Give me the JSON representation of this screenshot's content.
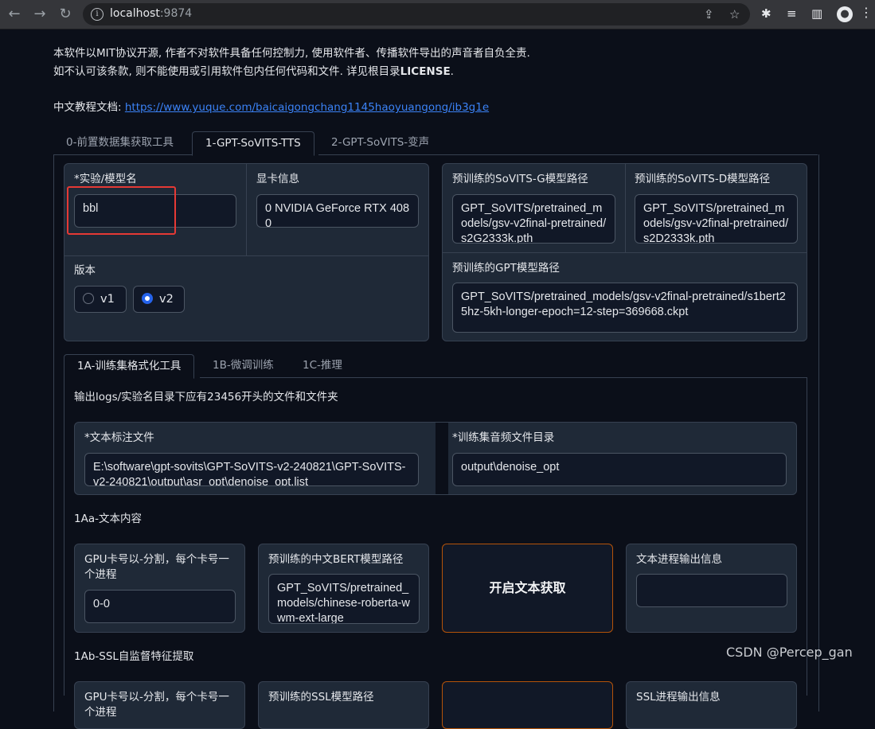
{
  "browser": {
    "url_host": "localhost",
    "url_port": ":9874",
    "back_glyph": "←",
    "forward_glyph": "→",
    "reload_glyph": "↻",
    "info_glyph": "i",
    "share_glyph": "⇪",
    "star_glyph": "☆",
    "extensions_glyph": "✱",
    "media_glyph": "≡",
    "sidepanel_glyph": "▥",
    "profile_glyph": "●",
    "menu_glyph": "⋮"
  },
  "notice": {
    "line1": "本软件以MIT协议开源, 作者不对软件具备任何控制力, 使用软件者、传播软件导出的声音者自负全责.",
    "line2_prefix": "如不认可该条款, 则不能使用或引用软件包内任何代码和文件. 详见根目录",
    "line2_bold": "LICENSE",
    "line2_suffix": ".",
    "tutorial_label": "中文教程文档: ",
    "tutorial_link": "https://www.yuque.com/baicaigongchang1145haoyuangong/ib3g1e"
  },
  "top_tabs": [
    {
      "label": "0-前置数据集获取工具"
    },
    {
      "label": "1-GPT-SoVITS-TTS"
    },
    {
      "label": "2-GPT-SoVITS-变声"
    }
  ],
  "experiment": {
    "name_label": "*实验/模型名",
    "name_value": "bbl",
    "gpu_label": "显卡信息",
    "gpu_value": "0  NVIDIA GeForce RTX 4080",
    "version_label": "版本",
    "versions": [
      "v1",
      "v2"
    ],
    "selected_version": "v2"
  },
  "pretrained": {
    "sovits_g_label": "预训练的SoVITS-G模型路径",
    "sovits_g_value": "GPT_SoVITS/pretrained_models/gsv-v2final-pretrained/s2G2333k.pth",
    "sovits_d_label": "预训练的SoVITS-D模型路径",
    "sovits_d_value": "GPT_SoVITS/pretrained_models/gsv-v2final-pretrained/s2D2333k.pth",
    "gpt_label": "预训练的GPT模型路径",
    "gpt_value": "GPT_SoVITS/pretrained_models/gsv-v2final-pretrained/s1bert25hz-5kh-longer-epoch=12-step=369668.ckpt"
  },
  "sub_tabs": [
    {
      "label": "1A-训练集格式化工具"
    },
    {
      "label": "1B-微调训练"
    },
    {
      "label": "1C-推理"
    }
  ],
  "format_tool": {
    "hint": "输出logs/实验名目录下应有23456开头的文件和文件夹",
    "text_label_file_label": "*文本标注文件",
    "text_label_file_value": "E:\\software\\gpt-sovits\\GPT-SoVITS-v2-240821\\GPT-SoVITS-v2-240821\\output\\asr_opt\\denoise_opt.list",
    "audio_dir_label": "*训练集音频文件目录",
    "audio_dir_value": "output\\denoise_opt"
  },
  "section_1aa": {
    "title": "1Aa-文本内容",
    "gpu_label": "GPU卡号以-分割，每个卡号一个进程",
    "gpu_value": "0-0",
    "bert_label": "预训练的中文BERT模型路径",
    "bert_value": "GPT_SoVITS/pretrained_models/chinese-roberta-wwm-ext-large",
    "start_button": "开启文本获取",
    "output_label": "文本进程输出信息",
    "output_value": ""
  },
  "section_1ab": {
    "title": "1Ab-SSL自监督特征提取",
    "gpu_label": "GPU卡号以-分割，每个卡号一个进程",
    "ssl_label": "预训练的SSL模型路径",
    "output_label": "SSL进程输出信息"
  },
  "watermark": "CSDN @Percep_gan"
}
